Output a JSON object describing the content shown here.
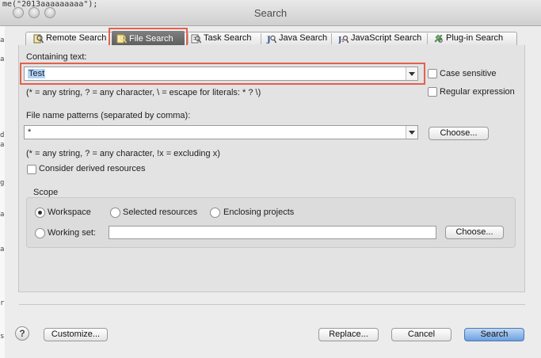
{
  "window": {
    "title": "Search",
    "background_code_snippet": "me(\"2013aaaaaaaaa\");",
    "background_code_margin": [
      "a",
      "a",
      "d",
      "a",
      "g",
      "a",
      "a",
      "r",
      "s"
    ]
  },
  "tabs": [
    {
      "label": "Remote Search",
      "icon": "remote-search-icon",
      "active": false
    },
    {
      "label": "File Search",
      "icon": "file-search-icon",
      "active": true
    },
    {
      "label": "Task Search",
      "icon": "task-search-icon",
      "active": false
    },
    {
      "label": "Java Search",
      "icon": "java-search-icon",
      "active": false
    },
    {
      "label": "JavaScript Search",
      "icon": "javascript-search-icon",
      "active": false
    },
    {
      "label": "Plug-in Search",
      "icon": "plugin-search-icon",
      "active": false
    }
  ],
  "containing_text": {
    "label": "Containing text:",
    "value": "Test",
    "hint": "(* = any string, ? = any character, \\ = escape for literals: * ? \\)",
    "case_sensitive": {
      "label": "Case sensitive",
      "checked": false
    },
    "regular_expression": {
      "label": "Regular expression",
      "checked": false
    }
  },
  "file_name_patterns": {
    "label": "File name patterns (separated by comma):",
    "value": "*",
    "choose_label": "Choose...",
    "hint": "(* = any string, ? = any character, !x = excluding x)"
  },
  "derived_resources": {
    "label": "Consider derived resources",
    "checked": false
  },
  "scope": {
    "title": "Scope",
    "workspace": {
      "label": "Workspace",
      "selected": true
    },
    "selected_resources": {
      "label": "Selected resources",
      "selected": false
    },
    "enclosing_projects": {
      "label": "Enclosing projects",
      "selected": false
    },
    "working_set": {
      "label": "Working set:",
      "selected": false,
      "value": ""
    },
    "choose_label": "Choose..."
  },
  "footer": {
    "help_label": "?",
    "customize_label": "Customize...",
    "replace_label": "Replace...",
    "cancel_label": "Cancel",
    "search_label": "Search"
  },
  "colors": {
    "highlight": "#e4604e",
    "primary_button": "#6ba1e1",
    "selection": "#b3d4fd"
  }
}
